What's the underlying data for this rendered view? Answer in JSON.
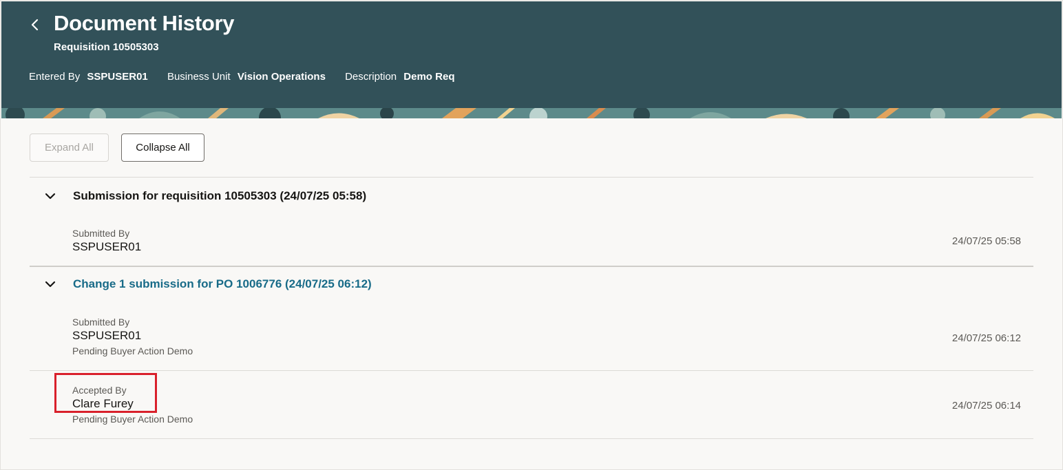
{
  "header": {
    "title": "Document History",
    "subtitle": "Requisition 10505303",
    "meta": [
      {
        "label": "Entered By",
        "value": "SSPUSER01"
      },
      {
        "label": "Business Unit",
        "value": "Vision Operations"
      },
      {
        "label": "Description",
        "value": "Demo Req"
      }
    ],
    "back_icon": "chevron-left-icon",
    "bg_color": "#325159"
  },
  "toolbar": {
    "expand_all_label": "Expand All",
    "collapse_all_label": "Collapse All"
  },
  "sections": [
    {
      "title": "Submission for requisition 10505303 (24/07/25 05:58)",
      "is_link": false,
      "entries": [
        {
          "label": "Submitted By",
          "value": "SSPUSER01",
          "note": "",
          "timestamp": "24/07/25 05:58"
        }
      ]
    },
    {
      "title": "Change 1 submission for PO 1006776 (24/07/25 06:12)",
      "is_link": true,
      "entries": [
        {
          "label": "Submitted By",
          "value": "SSPUSER01",
          "note": "Pending Buyer Action Demo",
          "timestamp": "24/07/25 06:12"
        },
        {
          "label": "Accepted By",
          "value": "Clare Furey",
          "note": "Pending Buyer Action Demo",
          "timestamp": "24/07/25 06:14"
        }
      ]
    }
  ],
  "colors": {
    "link": "#186b88",
    "highlight": "#d9202b"
  }
}
